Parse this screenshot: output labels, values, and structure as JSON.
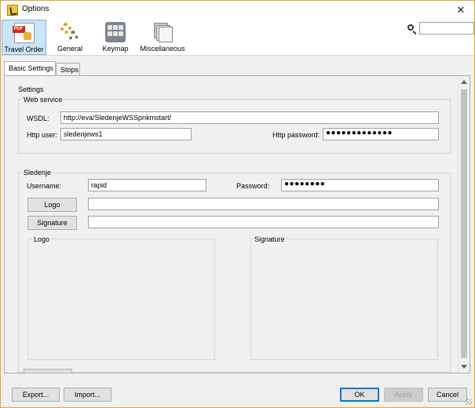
{
  "window": {
    "title": "Options",
    "close_glyph": "✕"
  },
  "toolbar": {
    "items": [
      {
        "label": "Travel Order",
        "icon": "travel-order-icon",
        "active": true
      },
      {
        "label": "General",
        "icon": "gears-icon",
        "active": false
      },
      {
        "label": "Keymap",
        "icon": "keyboard-icon",
        "active": false
      },
      {
        "label": "Miscellaneous",
        "icon": "miscellaneous-icon",
        "active": false
      }
    ],
    "search": {
      "value": "",
      "icon": "search-icon"
    }
  },
  "tabs": [
    {
      "label": "Basic Settings",
      "active": true
    },
    {
      "label": "Stops",
      "active": false
    }
  ],
  "settings": {
    "title": "Settings",
    "web_service": {
      "title": "Web service",
      "wsdl_label": "WSDL:",
      "wsdl_value": "http://eva/SledenjeWSSpnkmstart/",
      "http_user_label": "Http user:",
      "http_user_value": "sledenjews1",
      "http_password_label": "Http password:",
      "http_password_value": "●●●●●●●●●●●●●"
    },
    "sledenje": {
      "title": "Sledenje",
      "username_label": "Username:",
      "username_value": "rapid",
      "password_label": "Password:",
      "password_value": "●●●●●●●●",
      "logo_button": "Logo",
      "logo_path": "",
      "signature_button": "Signature",
      "signature_path": "",
      "logo_panel_title": "Logo",
      "signature_panel_title": "Signature"
    }
  },
  "footer": {
    "export_label": "Export...",
    "import_label": "Import...",
    "ok_label": "OK",
    "apply_label": "Apply",
    "cancel_label": "Cancel"
  },
  "colors": {
    "accent": "#0078d7",
    "active_tool_bg": "#cce4f7",
    "window_border": "#e8a23a"
  }
}
